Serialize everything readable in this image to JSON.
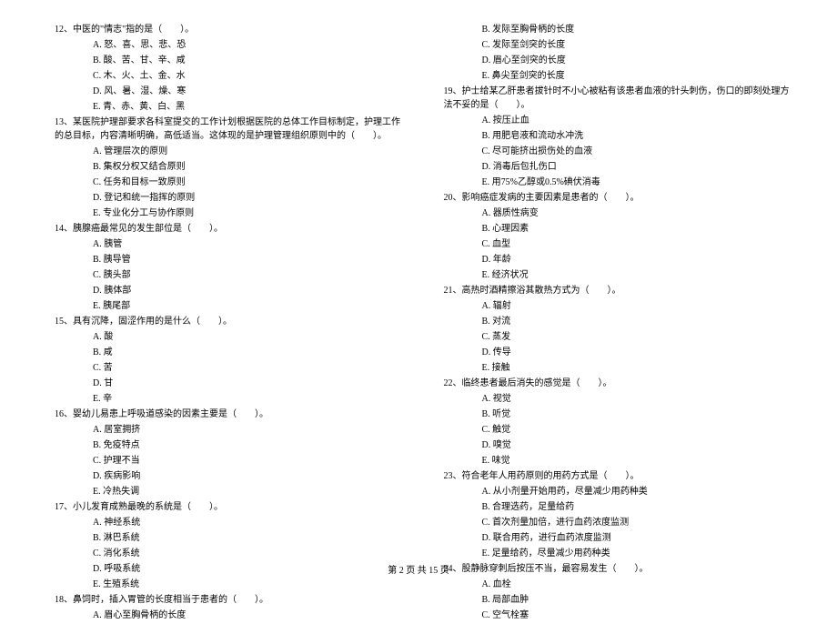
{
  "left": {
    "q12": {
      "text": "12、中医的\"情志\"指的是（　　）。",
      "options": [
        "A. 怒、喜、思、悲、恐",
        "B. 酸、苦、甘、辛、咸",
        "C. 木、火、土、金、水",
        "D. 风、暑、湿、燥、寒",
        "E. 青、赤、黄、白、黑"
      ]
    },
    "q13": {
      "text": "13、某医院护理部要求各科室提交的工作计划根据医院的总体工作目标制定，护理工作的总目标，内容清晰明确，高低适当。这体现的是护理管理组织原则中的（　　）。",
      "options": [
        "A. 管理层次的原则",
        "B. 集权分权又结合原则",
        "C. 任务和目标一致原则",
        "D. 登记和统一指挥的原则",
        "E. 专业化分工与协作原则"
      ]
    },
    "q14": {
      "text": "14、胰腺癌最常见的发生部位是（　　）。",
      "options": [
        "A. 胰管",
        "B. 胰导管",
        "C. 胰头部",
        "D. 胰体部",
        "E. 胰尾部"
      ]
    },
    "q15": {
      "text": "15、具有沉降，固涩作用的是什么（　　）。",
      "options": [
        "A. 酸",
        "B. 咸",
        "C. 苦",
        "D. 甘",
        "E. 辛"
      ]
    },
    "q16": {
      "text": "16、婴幼儿易患上呼吸道感染的因素主要是（　　）。",
      "options": [
        "A. 居室拥挤",
        "B. 免疫特点",
        "C. 护理不当",
        "D. 疾病影响",
        "E. 冷热失调"
      ]
    },
    "q17": {
      "text": "17、小儿发育成熟最晚的系统是（　　）。",
      "options": [
        "A. 神经系统",
        "B. 淋巴系统",
        "C. 消化系统",
        "D. 呼吸系统",
        "E. 生殖系统"
      ]
    },
    "q18": {
      "text": "18、鼻饲时，插入胃管的长度相当于患者的（　　）。",
      "options": [
        "A. 眉心至胸骨柄的长度"
      ]
    }
  },
  "right": {
    "q18_cont": [
      "B. 发际至胸骨柄的长度",
      "C. 发际至剑突的长度",
      "D. 眉心至剑突的长度",
      "E. 鼻尖至剑突的长度"
    ],
    "q19": {
      "text": "19、护士给某乙肝患者拔针时不小心被粘有该患者血液的针头刺伤，伤口的即刻处理方法不妥的是（　　）。",
      "options": [
        "A. 按压止血",
        "B. 用肥皂液和流动水冲洗",
        "C. 尽可能挤出损伤处的血液",
        "D. 消毒后包扎伤口",
        "E. 用75%乙醇或0.5%碘伏消毒"
      ]
    },
    "q20": {
      "text": "20、影响癌症发病的主要因素是患者的（　　）。",
      "options": [
        "A. 器质性病变",
        "B. 心理因素",
        "C. 血型",
        "D. 年龄",
        "E. 经济状况"
      ]
    },
    "q21": {
      "text": "21、高热时酒精擦浴其散热方式为（　　）。",
      "options": [
        "A. 辐射",
        "B. 对流",
        "C. 蒸发",
        "D. 传导",
        "E. 接触"
      ]
    },
    "q22": {
      "text": "22、临终患者最后消失的感觉是（　　）。",
      "options": [
        "A. 视觉",
        "B. 听觉",
        "C. 触觉",
        "D. 嗅觉",
        "E. 味觉"
      ]
    },
    "q23": {
      "text": "23、符合老年人用药原则的用药方式是（　　）。",
      "options": [
        "A. 从小剂量开始用药，尽量减少用药种类",
        "B. 合理选药，足量给药",
        "C. 首次剂量加倍，进行血药浓度监测",
        "D. 联合用药，进行血药浓度监测",
        "E. 足量给药，尽量减少用药种类"
      ]
    },
    "q24": {
      "text": "24、股静脉穿刺后按压不当，最容易发生（　　）。",
      "options": [
        "A. 血栓",
        "B. 局部血肿",
        "C. 空气栓塞"
      ]
    }
  },
  "footer": "第 2 页 共 15 页"
}
